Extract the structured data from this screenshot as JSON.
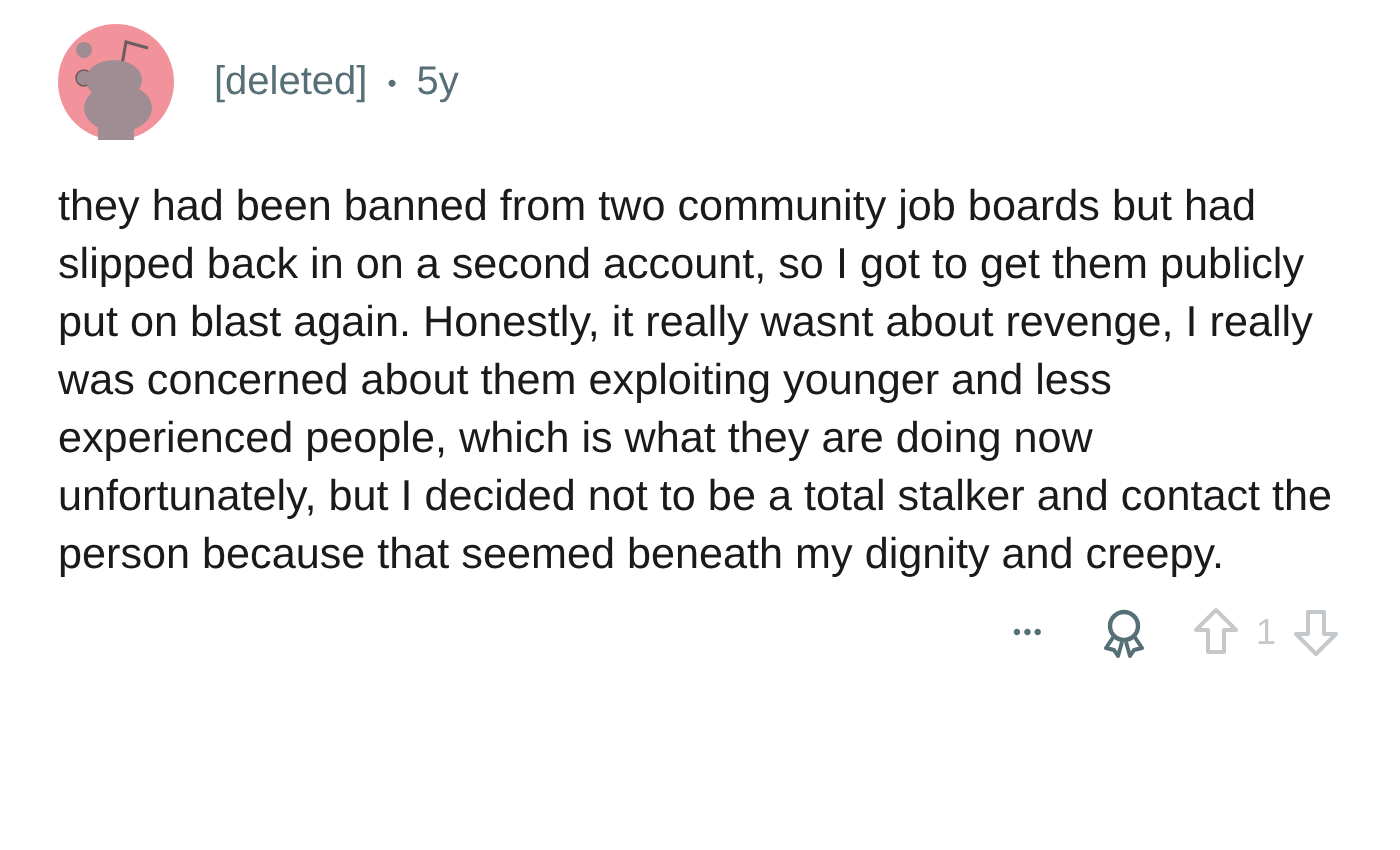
{
  "comment": {
    "author": "[deleted]",
    "separator": "•",
    "age": "5y",
    "body": "they had been banned from two community job boards but had slipped back in on a second account, so I got to get them publicly put on blast again. Honestly, it really wasnt about revenge, I really was concerned about them exploiting younger and less experienced people, which is what they are doing now unfortunately, but I decided not to be a total stalker and contact the person because that seemed beneath my dignity and creepy.",
    "more": "•••",
    "score": "1"
  }
}
